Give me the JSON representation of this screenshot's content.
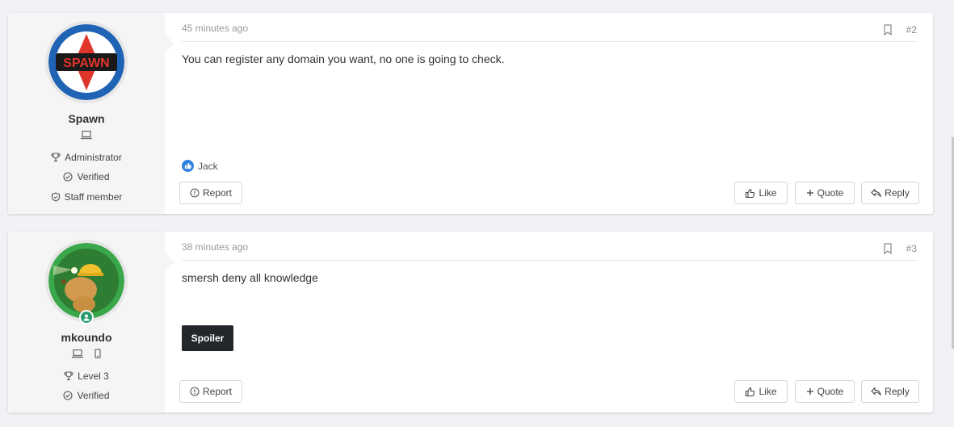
{
  "posts": [
    {
      "username": "Spawn",
      "avatar_text": "SPAWN",
      "stats": [
        "Administrator",
        "Verified",
        "Staff member"
      ],
      "time": "45 minutes ago",
      "number": "#2",
      "body": "You can register any domain you want, no one is going to check.",
      "reaction_user": "Jack",
      "actions": {
        "report": "Report",
        "like": "Like",
        "quote": "Quote",
        "reply": "Reply"
      }
    },
    {
      "username": "mkoundo",
      "stats": [
        "Level 3",
        "Verified"
      ],
      "time": "38 minutes ago",
      "number": "#3",
      "body": "smersh deny all knowledge",
      "spoiler_label": "Spoiler",
      "actions": {
        "report": "Report",
        "like": "Like",
        "quote": "Quote",
        "reply": "Reply"
      }
    }
  ],
  "colors": {
    "accent": "#2f80e0",
    "spoiler_bg": "#23262b",
    "online": "#2a9d6e"
  },
  "icons": [
    "laptop-icon",
    "mobile-icon",
    "trophy-icon",
    "check-circle-icon",
    "shield-icon",
    "bookmark-icon",
    "thumbs-up-icon",
    "plus-icon",
    "reply-icon",
    "alert-icon"
  ]
}
